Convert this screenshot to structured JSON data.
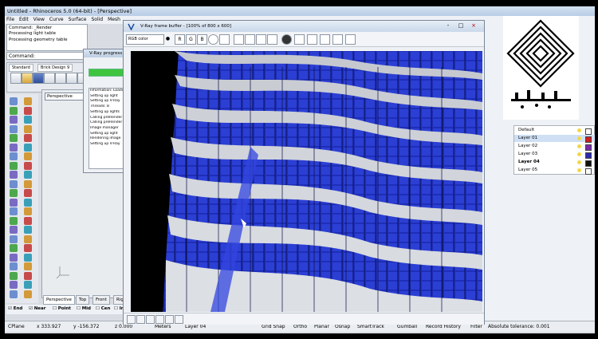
{
  "app": {
    "title": "Untitled - Rhinoceros 5.0 (64-bit) - [Perspective]",
    "menu": [
      "File",
      "Edit",
      "View",
      "Curve",
      "Surface",
      "Solid",
      "Mesh"
    ]
  },
  "command_history": [
    "Command: _Render",
    "Processing light table",
    "Processing geometry table"
  ],
  "command_prompt": "Command:",
  "toolbar_tabs": [
    "Standard",
    "Brick Design 9"
  ],
  "vray_progress": {
    "title": "V-Ray progress",
    "log": [
      "Information: Loading",
      "Setting up light",
      "Setting up V-Ray",
      "Threads: 8",
      "Setting up lights",
      "Calling preRender",
      "Calling preRender",
      "Image manager",
      "Setting up light",
      "Rendering image",
      "Setting up V-Ray"
    ]
  },
  "viewport": {
    "label": "Perspective",
    "tabs": [
      "Perspective",
      "Top",
      "Front",
      "Right"
    ]
  },
  "osnap": [
    "End",
    "Near",
    "Point",
    "Mid",
    "Cen",
    "Int"
  ],
  "frame_buffer": {
    "title": "V-Ray frame buffer - [100% of 800 x 600]",
    "channel": "RGB color",
    "buttons": [
      "R",
      "G",
      "B"
    ],
    "window_controls": [
      "-",
      "□",
      "×"
    ]
  },
  "layers": [
    {
      "name": "Default",
      "color": "#ffffff"
    },
    {
      "name": "Layer 01",
      "color": "#cc2020"
    },
    {
      "name": "Layer 02",
      "color": "#7b2ca8"
    },
    {
      "name": "Layer 03",
      "color": "#2a2ab0"
    },
    {
      "name": "Layer 04",
      "color": "#111111",
      "bold": true
    },
    {
      "name": "Layer 05",
      "color": "#ffffff"
    }
  ],
  "statusbar": {
    "cplane": "CPlane",
    "x": "x 333.927",
    "y": "y -156.372",
    "z": "z 0.000",
    "meters": "Meters",
    "layer": "Layer 04",
    "grid_snap": "Grid Snap",
    "ortho": "Ortho",
    "planar": "Planar",
    "osnap": "Osnap",
    "smarttrack": "SmartTrack",
    "gumball": "Gumball",
    "record_history": "Record History",
    "filter": "Filter",
    "tolerance": "Absolute tolerance: 0.001"
  },
  "colors": {
    "accent": "#2a3fd0",
    "render_bg": "#000000",
    "frame_title": "#c9d8ea"
  }
}
